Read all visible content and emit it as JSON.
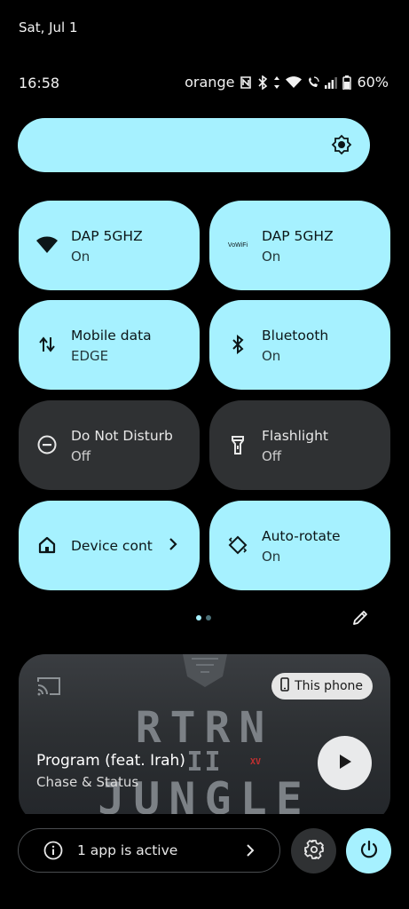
{
  "status": {
    "date": "Sat, Jul 1",
    "time": "16:58",
    "carrier": "orange",
    "battery": "60%"
  },
  "brightness": {
    "icon": "brightness-icon"
  },
  "tiles": [
    {
      "title": "DAP 5GHZ",
      "subtitle": "On",
      "state": "on",
      "icon": "wifi-icon"
    },
    {
      "title": "DAP 5GHZ",
      "subtitle": "On",
      "state": "on",
      "icon": "vowifi-icon",
      "icon_text": "VoWiFi"
    },
    {
      "title": "Mobile data",
      "subtitle": "EDGE",
      "state": "on",
      "icon": "mobile-data-icon"
    },
    {
      "title": "Bluetooth",
      "subtitle": "On",
      "state": "on",
      "icon": "bluetooth-icon"
    },
    {
      "title": "Do Not Disturb",
      "subtitle": "Off",
      "state": "off",
      "icon": "do-not-disturb-icon"
    },
    {
      "title": "Flashlight",
      "subtitle": "Off",
      "state": "off",
      "icon": "flashlight-icon"
    },
    {
      "title": "Device controls",
      "state": "on",
      "icon": "home-icon"
    },
    {
      "title": "Auto-rotate",
      "subtitle": "On",
      "state": "on",
      "icon": "auto-rotate-icon"
    }
  ],
  "pager": {
    "pages": 2,
    "current": 1
  },
  "media": {
    "title": "Program (feat. Irah)",
    "artist": "Chase & Status",
    "output": "This phone",
    "art_line1": "RTRN",
    "art_line2": "II",
    "art_line3": "JUNGLE",
    "art_mark": "XV"
  },
  "footer": {
    "active_apps": "1 app is active"
  },
  "colors": {
    "accent": "#a6f1ff",
    "tile_off": "#2f3133",
    "background": "#000000"
  }
}
